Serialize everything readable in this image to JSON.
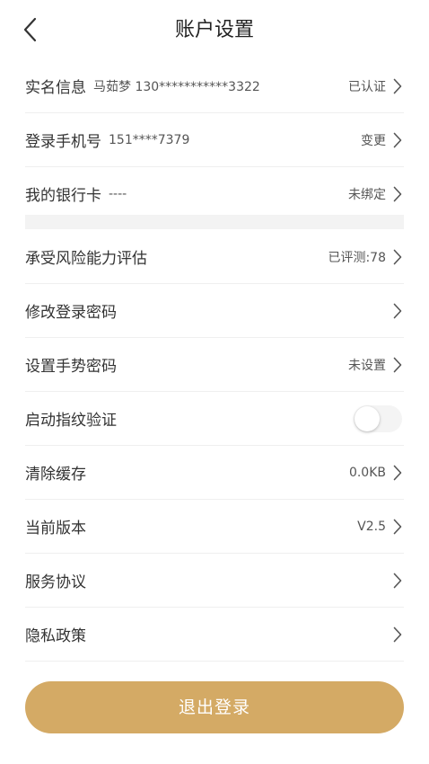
{
  "header": {
    "title": "账户设置"
  },
  "account": [
    {
      "label": "实名信息",
      "sub": "马茹梦 130***********3322",
      "value": "已认证"
    },
    {
      "label": "登录手机号",
      "sub": "151****7379",
      "value": "变更"
    },
    {
      "label": "我的银行卡",
      "sub": "----",
      "value": "未绑定"
    }
  ],
  "settings": [
    {
      "label": "承受风险能力评估",
      "value": "已评测:78"
    },
    {
      "label": "修改登录密码",
      "value": ""
    },
    {
      "label": "设置手势密码",
      "value": "未设置"
    },
    {
      "label": "启动指纹验证",
      "toggle": false
    },
    {
      "label": "清除缓存",
      "value": "0.0KB"
    },
    {
      "label": "当前版本",
      "value": "V2.5"
    },
    {
      "label": "服务协议",
      "value": ""
    },
    {
      "label": "隐私政策",
      "value": ""
    }
  ],
  "logout_label": "退出登录",
  "colors": {
    "accent": "#d4aa65"
  }
}
